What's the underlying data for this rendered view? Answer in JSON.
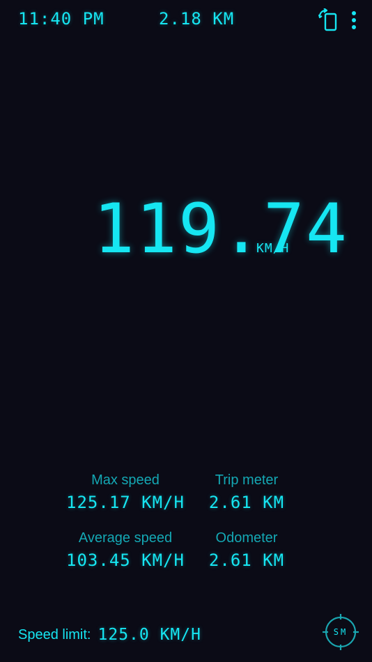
{
  "status_bar": {
    "time": "11:40 PM",
    "distance": "2.18 KM",
    "rotate_icon": "rotate-screen-icon",
    "menu_icon": "more-vertical-icon"
  },
  "speedometer": {
    "speed": "119.74",
    "unit": "KM/H"
  },
  "stats": [
    {
      "label": "Max speed",
      "value": "125.17 KM/H"
    },
    {
      "label": "Trip meter",
      "value": "2.61 KM"
    },
    {
      "label": "Average speed",
      "value": "103.45 KM/H"
    },
    {
      "label": "Odometer",
      "value": "2.61 KM"
    }
  ],
  "footer": {
    "limit_label": "Speed limit:",
    "limit_value": "125.0 KM/H",
    "mode_button_label": "SM",
    "mode_icon": "crosshair-icon"
  },
  "colors": {
    "background": "#0b0b16",
    "accent": "#16e6f2",
    "label": "#14a8b4"
  }
}
